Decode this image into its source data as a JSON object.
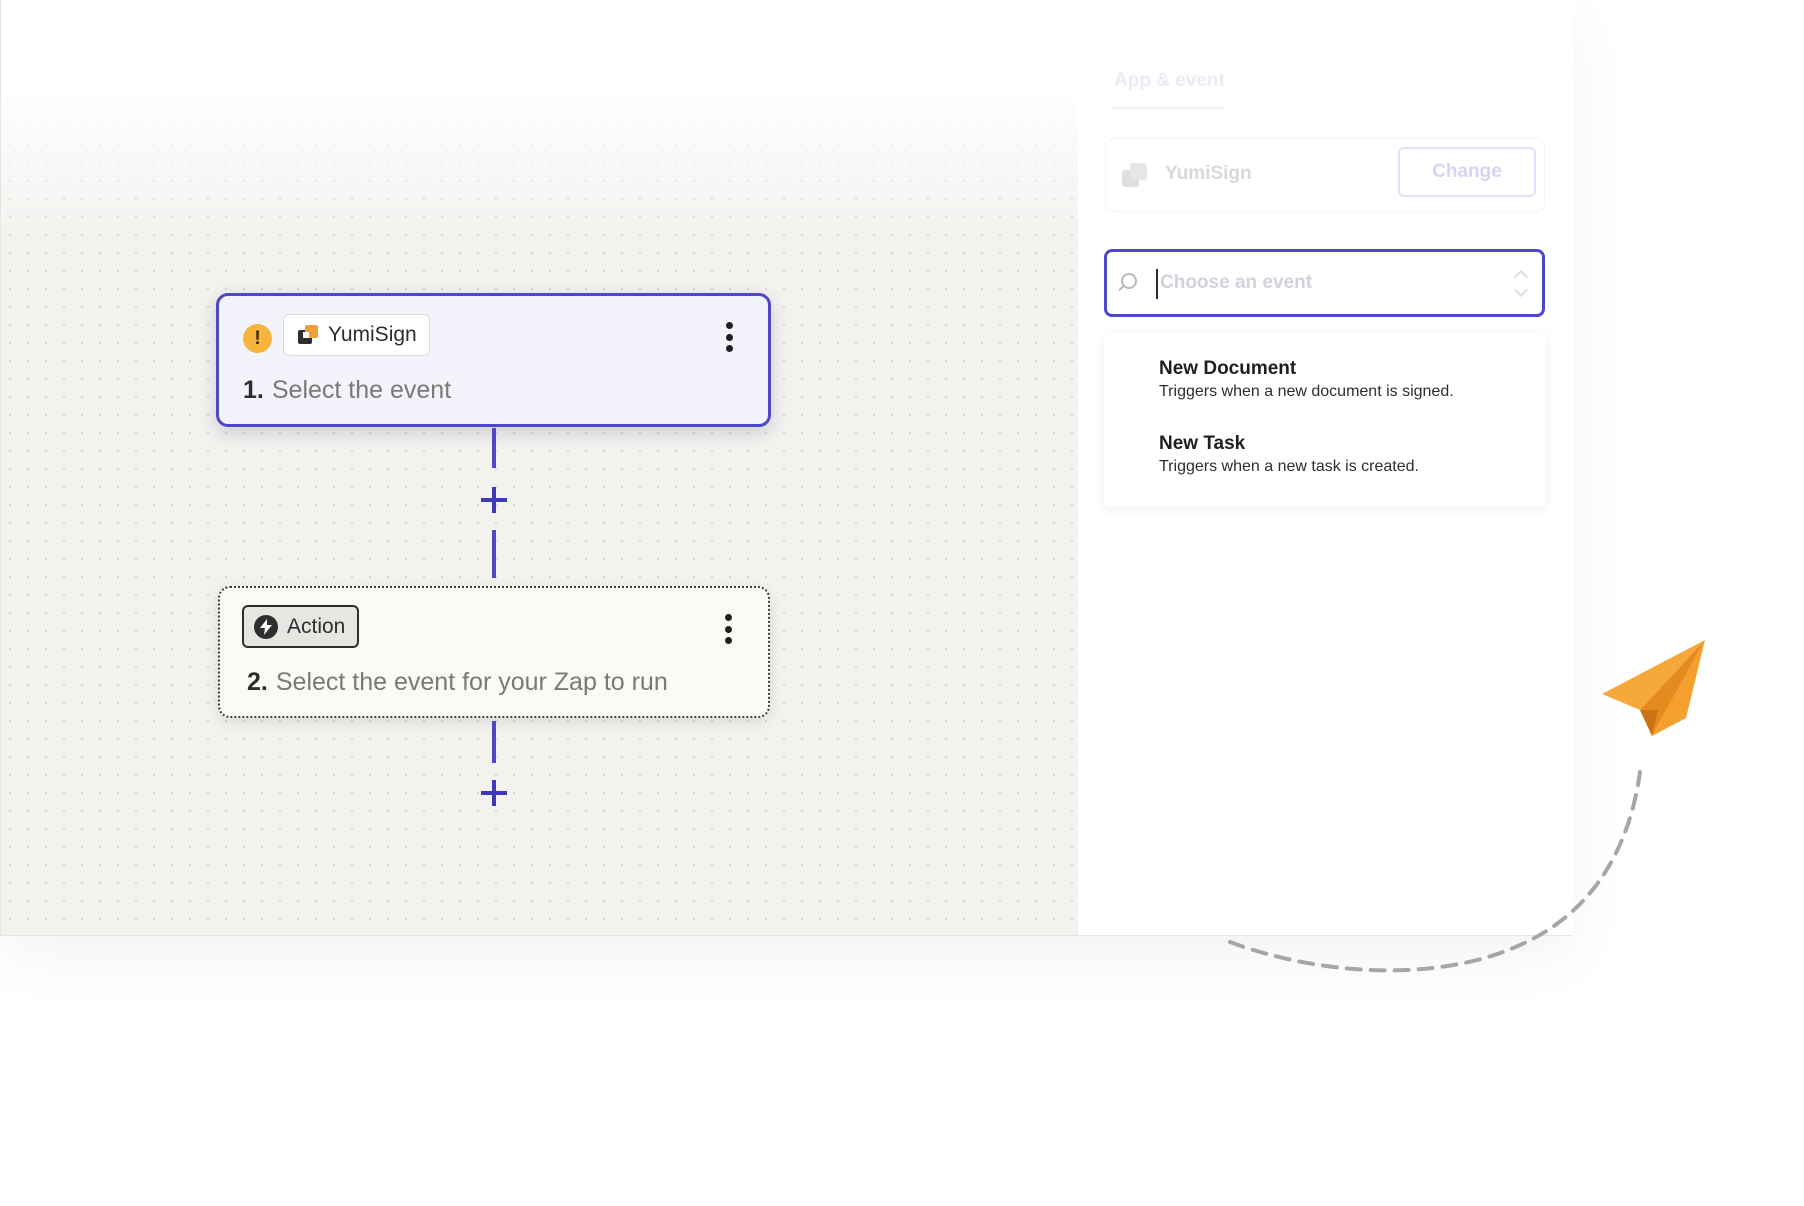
{
  "colors": {
    "accent": "#5046c8",
    "warning": "#f6b43d",
    "brand_orange": "#f29d38",
    "canvas_bg": "#f3f2ef"
  },
  "trigger_step": {
    "status_icon": "warning-icon",
    "app_name": "YumiSign",
    "number": "1.",
    "title": "Select the event",
    "menu_icon": "kebab-menu-icon"
  },
  "action_step": {
    "chip_icon": "bolt-icon",
    "chip_label": "Action",
    "number": "2.",
    "title": "Select the event for your Zap to run",
    "menu_icon": "kebab-menu-icon"
  },
  "connectors": {
    "add_icon": "plus-icon"
  },
  "panel": {
    "tab_label": "App & event",
    "app_name": "YumiSign",
    "change_label": "Change",
    "search_placeholder": "Choose an event",
    "search_value": "",
    "options": [
      {
        "title": "New Document",
        "description": "Triggers when a new document is signed."
      },
      {
        "title": "New Task",
        "description": "Triggers when a new task is created."
      }
    ]
  },
  "decoration": {
    "plane_icon": "paper-plane-icon"
  }
}
